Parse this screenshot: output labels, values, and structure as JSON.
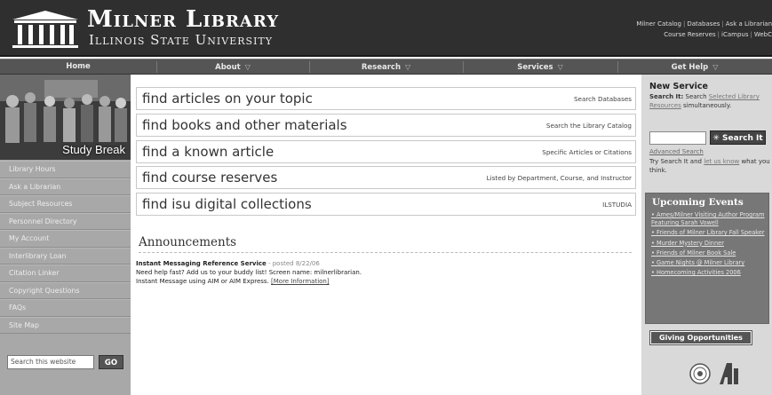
{
  "header": {
    "title": "Milner Library",
    "subtitle": "Illinois State University",
    "top_links_row1": [
      "Milner Catalog",
      "Databases",
      "Ask a Librarian"
    ],
    "top_links_row2": [
      "Course Reserves",
      "iCampus",
      "WebC"
    ]
  },
  "nav": {
    "items": [
      {
        "label": "Home",
        "has_menu": false
      },
      {
        "label": "About",
        "has_menu": true
      },
      {
        "label": "Research",
        "has_menu": true
      },
      {
        "label": "Services",
        "has_menu": true
      },
      {
        "label": "Get Help",
        "has_menu": true
      }
    ],
    "menu_glyph": "▽"
  },
  "left": {
    "photo_caption": "Study Break",
    "links": [
      "Library Hours",
      "Ask a Librarian",
      "Subject Resources",
      "Personnel Directory",
      "My Account",
      "Interlibrary Loan",
      "Citation Linker",
      "Copyright Questions",
      "FAQs",
      "Site Map"
    ],
    "search_placeholder": "Search this website",
    "search_button": "GO"
  },
  "main": {
    "find_rows": [
      {
        "title": "find articles on your topic",
        "link": "Search Databases"
      },
      {
        "title": "find books and other materials",
        "link": "Search the Library Catalog"
      },
      {
        "title": "find a known article",
        "link": "Specific Articles or Citations"
      },
      {
        "title": "find course reserves",
        "link": "Listed by Department, Course, and Instructor"
      },
      {
        "title": "find isu digital collections",
        "link": "ILSTUDIA"
      }
    ],
    "announcements_heading": "Announcements",
    "announcement": {
      "title": "Instant Messaging Reference Service",
      "posted": " - posted 8/22/06",
      "line1": "Need help fast? Add us to your buddy list! Screen name: milnerlibrarian.",
      "line2": "Instant Message using AIM or AIM Express. ",
      "more": "[More Information]"
    }
  },
  "right": {
    "new_service_heading": "New Service",
    "new_service_prefix": "Search It:",
    "new_service_mid": " Search ",
    "new_service_link": "Selected Library Resources",
    "new_service_suffix": " simultaneously.",
    "search_button": "Search It",
    "advanced_search": "Advanced Search",
    "try_prefix": "Try Search It and ",
    "try_link": "let us know",
    "try_suffix": " what you think.",
    "events_heading": "Upcoming Events",
    "events": [
      "Ames/Milner Visiting Author Program Featuring Sarah Vowell",
      "Friends of Milner Library Fall Speaker",
      "Murder Mystery Dinner",
      "Friends of Milner Book Sale",
      "Game Nights @ Milner Library",
      "Homecoming Activities 2006"
    ],
    "giving_button": "Giving Opportunities"
  },
  "colors": {
    "header_bg": "#2f2f2f",
    "nav_bg": "#555555",
    "left_bg": "#a8a8a8",
    "right_bg": "#d9d9d9",
    "events_bg": "#777777"
  }
}
